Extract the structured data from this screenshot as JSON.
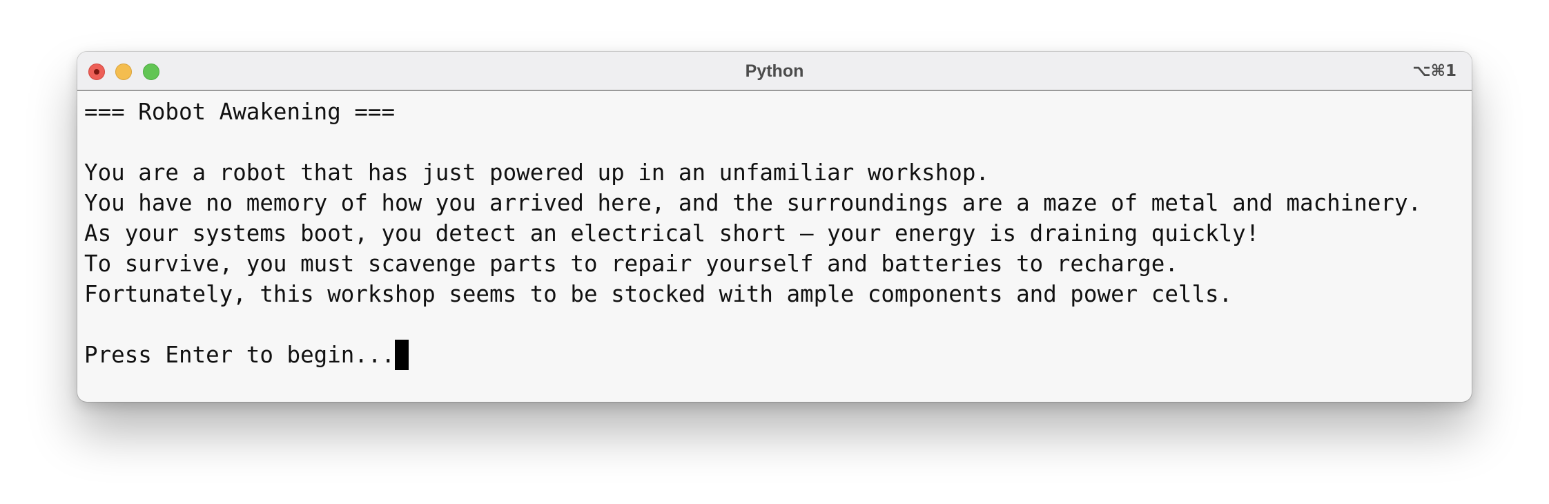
{
  "window": {
    "title": "Python",
    "shortcut": "⌥⌘1"
  },
  "terminal": {
    "lines": [
      "=== Robot Awakening ===",
      "",
      "You are a robot that has just powered up in an unfamiliar workshop.",
      "You have no memory of how you arrived here, and the surroundings are a maze of metal and machinery.",
      "As your systems boot, you detect an electrical short — your energy is draining quickly!",
      "To survive, you must scavenge parts to repair yourself and batteries to recharge.",
      "Fortunately, this workshop seems to be stocked with ample components and power cells.",
      "",
      "Press Enter to begin..."
    ]
  },
  "colors": {
    "close": "#ed5f57",
    "minimize": "#f4bd4f",
    "maximize": "#62c554",
    "terminal_bg": "#f7f7f7",
    "text": "#111111"
  }
}
